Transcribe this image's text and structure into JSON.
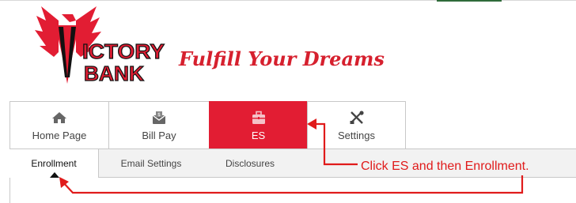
{
  "brand": {
    "logo_line1": "ICTORY",
    "logo_line2": "BANK",
    "tagline": "Fulfill Your Dreams",
    "color": "#e21d33"
  },
  "tabs": [
    {
      "label": "Home Page",
      "icon": "home-icon"
    },
    {
      "label": "Bill Pay",
      "icon": "bill-pay-icon"
    },
    {
      "label": "ES",
      "icon": "briefcase-icon",
      "active": true
    },
    {
      "label": "Settings",
      "icon": "tools-icon"
    }
  ],
  "subtabs": [
    {
      "label": "Enrollment",
      "active": true
    },
    {
      "label": "Email Settings"
    },
    {
      "label": "Disclosures"
    }
  ],
  "annotation": {
    "text": "Click ES and then Enrollment.",
    "color": "#e01b1b"
  }
}
